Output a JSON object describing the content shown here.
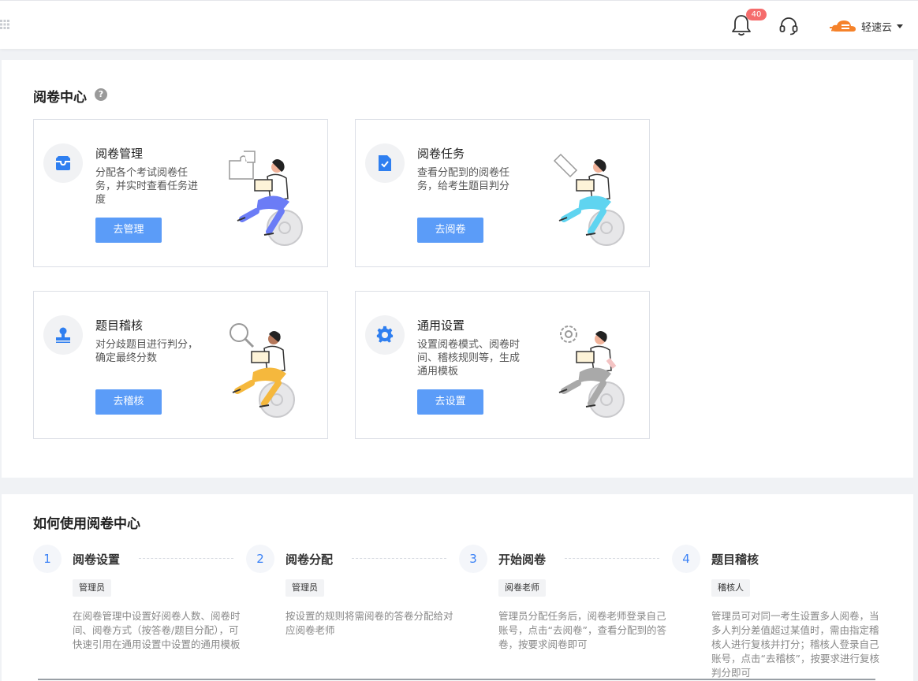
{
  "header": {
    "notification_count": "40",
    "brand_name": "轻速云"
  },
  "center": {
    "title": "阅卷中心",
    "help_glyph": "?",
    "cards": [
      {
        "title": "阅卷管理",
        "desc": "分配各个考试阅卷任务，并实时查看任务进度",
        "button": "去管理",
        "icon": "inbox-icon",
        "accent": "#6b7cf6"
      },
      {
        "title": "阅卷任务",
        "desc": "查看分配到的阅卷任务，给考生题目判分",
        "button": "去阅卷",
        "icon": "document-check-icon",
        "accent": "#5fd4f0"
      },
      {
        "title": "题目稽核",
        "desc": "对分歧题目进行判分，确定最终分数",
        "button": "去稽核",
        "icon": "stamp-icon",
        "accent": "#f5b83d"
      },
      {
        "title": "通用设置",
        "desc": "设置阅卷模式、阅卷时间、稽核规则等，生成通用模板",
        "button": "去设置",
        "icon": "gear-icon",
        "accent": "#a9a9a9"
      }
    ]
  },
  "howto": {
    "title": "如何使用阅卷中心",
    "steps": [
      {
        "num": "1",
        "title": "阅卷设置",
        "role": "管理员",
        "desc": "在阅卷管理中设置好阅卷人数、阅卷时间、阅卷方式（按答卷/题目分配），可快速引用在通用设置中设置的通用模板"
      },
      {
        "num": "2",
        "title": "阅卷分配",
        "role": "管理员",
        "desc": "按设置的规则将需阅卷的答卷分配给对应阅卷老师"
      },
      {
        "num": "3",
        "title": "开始阅卷",
        "role": "阅卷老师",
        "desc": "管理员分配任务后，阅卷老师登录自己账号，点击“去阅卷”，查看分配到的答卷，按要求阅卷即可"
      },
      {
        "num": "4",
        "title": "题目稽核",
        "role": "稽核人",
        "desc": "管理员可对同一考生设置多人阅卷，当多人判分差值超过某值时，需由指定稽核人进行复核并打分；稽核人登录自己账号，点击“去稽核”，按要求进行复核判分即可"
      }
    ]
  },
  "colors": {
    "primary_button": "#5b9cf8",
    "badge": "#f56c6c",
    "brand": "#f5822a"
  }
}
